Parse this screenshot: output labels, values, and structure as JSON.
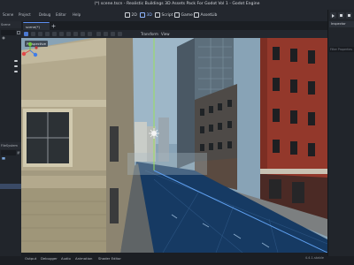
{
  "window": {
    "title": "(*) scene.tscn - Realistic Buildings 3D Assets Pack For Godot Vol 1 - Godot Engine"
  },
  "menu": [
    {
      "label": "Scene"
    },
    {
      "label": "Project"
    },
    {
      "label": "Debug"
    },
    {
      "label": "Editor"
    },
    {
      "label": "Help"
    }
  ],
  "workspaces": [
    {
      "label": "2D",
      "icon": "2d-grid-icon"
    },
    {
      "label": "3D",
      "icon": "cube-icon",
      "active": true
    },
    {
      "label": "Script",
      "icon": "script-icon"
    },
    {
      "label": "Game",
      "icon": "gamepad-icon"
    },
    {
      "label": "AssetLib",
      "icon": "assetlib-icon"
    }
  ],
  "left_dock": {
    "tab": "Scene",
    "bottom_tab": "FileSystem",
    "filter_placeholder": "Filter"
  },
  "scene_tab": {
    "label": "scene(*)"
  },
  "toolbar3d": {
    "transform_label": "Transform",
    "view_label": "View"
  },
  "viewport": {
    "perspective_label": "Perspective",
    "colors": {
      "sky": "#7e98ac",
      "road": "#143660",
      "red_building": "#9a3a2c",
      "stone_building": "#b6ad92",
      "gizmo_x": "#e04848",
      "gizmo_y": "#72c83c",
      "gizmo_z": "#3f7de8"
    }
  },
  "right_dock": {
    "tab": "Inspector",
    "filter_placeholder": "Filter Properties"
  },
  "bottom_panel": {
    "tabs": [
      "Output",
      "Debugger",
      "Audio",
      "Animation",
      "Shader Editor"
    ],
    "version": "4.4.1.stable"
  }
}
